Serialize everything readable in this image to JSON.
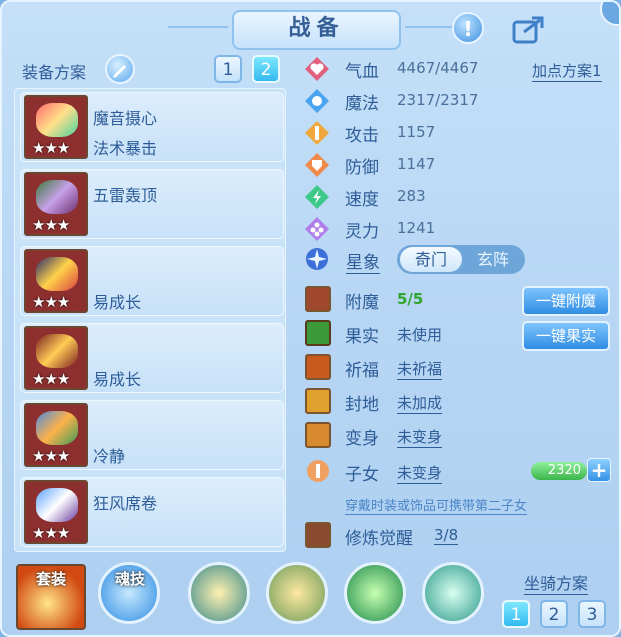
{
  "title": "战备",
  "equip_plan": {
    "label": "装备方案",
    "buttons": [
      "1",
      "2"
    ],
    "active": "2"
  },
  "equipment": [
    {
      "name": "魔音摄心",
      "attr": "法术暴击",
      "stars": "★★★"
    },
    {
      "name": "五雷轰顶",
      "attr": "",
      "stars": "★★★"
    },
    {
      "name": "",
      "attr": "易成长",
      "stars": "★★★"
    },
    {
      "name": "",
      "attr": "易成长",
      "stars": "★★★"
    },
    {
      "name": "",
      "attr": "冷静",
      "stars": "★★★"
    },
    {
      "name": "狂风席卷",
      "attr": "",
      "stars": "★★★"
    }
  ],
  "stats": [
    {
      "label": "气血",
      "value": "4467/4467",
      "icon": "heart-icon",
      "color": "#e0607e"
    },
    {
      "label": "魔法",
      "value": "2317/2317",
      "icon": "mana-icon",
      "color": "#4aa3ee"
    },
    {
      "label": "攻击",
      "value": "1157",
      "icon": "attack-icon",
      "color": "#f0a83c"
    },
    {
      "label": "防御",
      "value": "1147",
      "icon": "defense-icon",
      "color": "#f08a4a"
    },
    {
      "label": "速度",
      "value": "283",
      "icon": "speed-icon",
      "color": "#3cc98a"
    },
    {
      "label": "灵力",
      "value": "1241",
      "icon": "spirit-icon",
      "color": "#b07ee8"
    }
  ],
  "add_point_plan": "加点方案1",
  "xingxiang": {
    "label": "星象",
    "options": [
      "奇门",
      "玄阵"
    ],
    "active": "奇门"
  },
  "extras": [
    {
      "label": "附魔",
      "value": "5/5"
    },
    {
      "label": "果实",
      "value": "未使用"
    },
    {
      "label": "祈福",
      "value": "未祈福"
    },
    {
      "label": "封地",
      "value": "未加成"
    },
    {
      "label": "变身",
      "value": "未变身"
    },
    {
      "label": "子女",
      "value": "未变身"
    }
  ],
  "buttons": {
    "one_key_enchant": "一键附魔",
    "one_key_fruit": "一键果实"
  },
  "child_hint": "穿戴时装或饰品可携带第二子女",
  "child_points": "2320",
  "cultivation": {
    "label": "修炼觉醒",
    "value": "3/8"
  },
  "bottom": {
    "suit_label": "套装",
    "soul_label": "魂技",
    "mount_label": "坐骑方案",
    "mount_buttons": [
      "1",
      "2",
      "3"
    ],
    "mount_active": "1"
  }
}
